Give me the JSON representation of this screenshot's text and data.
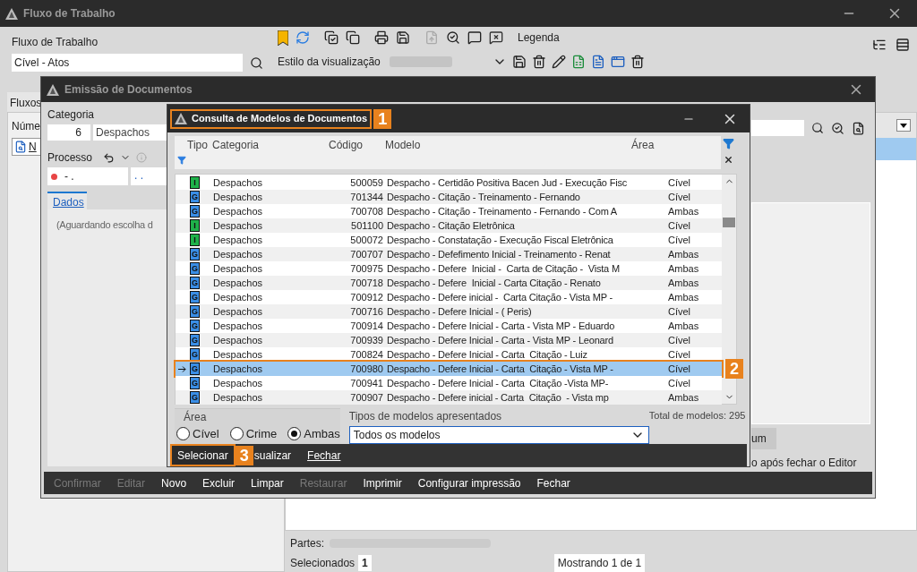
{
  "main_window": {
    "title": "Fluxo de Trabalho",
    "workflow_label": "Fluxo de Trabalho",
    "workflow_value": "Cível - Atos",
    "legend": "Legenda",
    "view_style_label": "Estilo da visualização",
    "left_tab": "Fluxos",
    "number_label": "Núme",
    "new_button": "N",
    "parties_label": "Partes:",
    "selected_label": "Selecionados",
    "selected_count": "1",
    "showing": "Mostrando 1 de 1"
  },
  "emission_window": {
    "title": "Emissão de Documentos",
    "category_label": "Categoria",
    "category_code": "6",
    "category_name": "Despachos",
    "process_label": "Processo",
    "process_number": "- .",
    "process_court": ". .",
    "tab": "Dados",
    "waiting_text": "(Aguardando escolha d",
    "side_button": "um",
    "editor_note": "o após fechar o Editor",
    "actions": [
      {
        "label": "Confirmar",
        "disabled": true
      },
      {
        "label": "Editar",
        "disabled": true
      },
      {
        "label": "Novo",
        "disabled": false
      },
      {
        "label": "Excluir",
        "disabled": false
      },
      {
        "label": "Limpar",
        "disabled": false
      },
      {
        "label": "Restaurar",
        "disabled": true
      },
      {
        "label": "Imprimir",
        "disabled": false
      },
      {
        "label": "Configurar impressão",
        "disabled": false
      },
      {
        "label": "Fechar",
        "disabled": false
      }
    ]
  },
  "query_window": {
    "title": "Consulta de Modelos de Documentos",
    "callout_1": "1",
    "callout_2": "2",
    "callout_3": "3",
    "columns": [
      "Tipo",
      "Categoria",
      "Código",
      "Modelo",
      "Área"
    ],
    "rows": [
      {
        "type": "I",
        "color": "#1fb24a",
        "category": "Despachos",
        "code": "500059",
        "model": "Despacho - Certidão Positiva Bacen Jud - Execução Fisc",
        "area": "Cível",
        "selected": false
      },
      {
        "type": "G",
        "color": "#3a8ee6",
        "category": "Despachos",
        "code": "701344",
        "model": "Despacho - Citação - Treinamento - Fernando",
        "area": "Cível",
        "selected": false
      },
      {
        "type": "G",
        "color": "#3a8ee6",
        "category": "Despachos",
        "code": "700708",
        "model": "Despacho - Citação - Treinamento - Fernando - Com A",
        "area": "Ambas",
        "selected": false
      },
      {
        "type": "I",
        "color": "#1fb24a",
        "category": "Despachos",
        "code": "501100",
        "model": "Despacho - Citação Eletrônica",
        "area": "Cível",
        "selected": false
      },
      {
        "type": "I",
        "color": "#1fb24a",
        "category": "Despachos",
        "code": "500072",
        "model": "Despacho - Constatação - Execução Fiscal Eletrônica",
        "area": "Cível",
        "selected": false
      },
      {
        "type": "G",
        "color": "#3a8ee6",
        "category": "Despachos",
        "code": "700707",
        "model": "Despacho - Defefimento Inicial - Treinamento - Renat",
        "area": "Ambas",
        "selected": false
      },
      {
        "type": "G",
        "color": "#3a8ee6",
        "category": "Despachos",
        "code": "700975",
        "model": "Despacho - Defere  Inicial -  Carta de Citação -  Vista M",
        "area": "Ambas",
        "selected": false
      },
      {
        "type": "G",
        "color": "#3a8ee6",
        "category": "Despachos",
        "code": "700718",
        "model": "Despacho - Defere  Inicial - Carta Citação - Renato",
        "area": "Ambas",
        "selected": false
      },
      {
        "type": "G",
        "color": "#3a8ee6",
        "category": "Despachos",
        "code": "700912",
        "model": "Despacho - Defere inicial -  Carta Citação - Vista MP -",
        "area": "Ambas",
        "selected": false
      },
      {
        "type": "G",
        "color": "#3a8ee6",
        "category": "Despachos",
        "code": "700716",
        "model": "Despacho - Defere Inicial - ( Peris)",
        "area": "Cível",
        "selected": false
      },
      {
        "type": "G",
        "color": "#3a8ee6",
        "category": "Despachos",
        "code": "700914",
        "model": "Despacho - Defere Inicial - Carta - Vista MP - Eduardo",
        "area": "Ambas",
        "selected": false
      },
      {
        "type": "G",
        "color": "#3a8ee6",
        "category": "Despachos",
        "code": "700939",
        "model": "Despacho - Defere Inicial - Carta - Vista MP - Leonard",
        "area": "Cível",
        "selected": false
      },
      {
        "type": "G",
        "color": "#3a8ee6",
        "category": "Despachos",
        "code": "700824",
        "model": "Despacho - Defere Inicial - Carta  Citação - Luiz",
        "area": "Cível",
        "selected": false
      },
      {
        "type": "G",
        "color": "#3a8ee6",
        "category": "Despachos",
        "code": "700980",
        "model": "Despacho - Defere Inicial - Carta  Citação - Vista MP -",
        "area": "Cível",
        "selected": true
      },
      {
        "type": "G",
        "color": "#3a8ee6",
        "category": "Despachos",
        "code": "700941",
        "model": "Despacho - Defere Inicial - Carta  Citação -Vista MP-",
        "area": "Cível",
        "selected": false
      },
      {
        "type": "G",
        "color": "#3a8ee6",
        "category": "Despachos",
        "code": "700907",
        "model": "Despacho - Defere inicial - Carta  Citação  - Vista mp",
        "area": "Ambas",
        "selected": false
      }
    ],
    "area_label": "Área",
    "area_options": [
      {
        "label": "Cível",
        "selected": false
      },
      {
        "label": "Crime",
        "selected": false
      },
      {
        "label": "Ambas",
        "selected": true
      }
    ],
    "model_types_label": "Tipos de modelos apresentados",
    "model_types_value": "Todos os modelos",
    "total": "Total de modelos: 295",
    "buttons": [
      "Selecionar",
      "sualizar",
      "Fechar"
    ]
  }
}
